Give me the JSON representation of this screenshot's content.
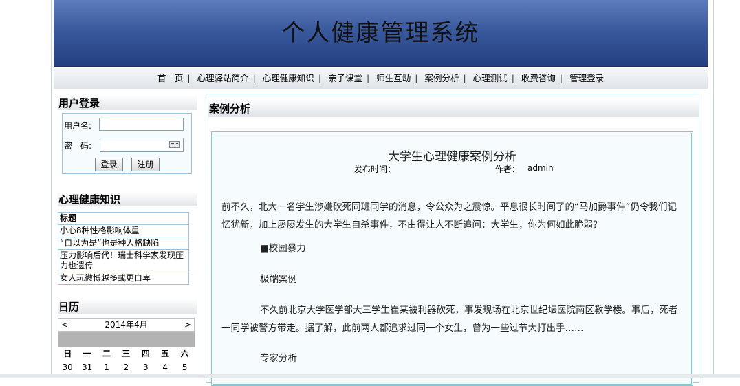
{
  "banner": {
    "title": "个人健康管理系统"
  },
  "nav": {
    "items": [
      "首　页",
      "心理驿站简介",
      "心理健康知识",
      "亲子课堂",
      "师生互动",
      "案例分析",
      "心理测试",
      "收费咨询",
      "管理登录"
    ],
    "separator": "|"
  },
  "login": {
    "title": "用户登录",
    "username_label": "用户名:",
    "password_label": "密　码:",
    "username_value": "",
    "password_value": "",
    "login_button": "登录",
    "register_button": "注册"
  },
  "knowledge": {
    "title": "心理健康知识",
    "header": "标题",
    "items": [
      "小心8种性格影响体重",
      "“自以为是”也是种人格缺陷",
      "压力影响后代！瑞士科学家发现压力也遗传",
      "女人玩微博越多或更自卑"
    ]
  },
  "calendar": {
    "title": "日历",
    "month": "2014年4月",
    "prev": "<",
    "next": ">",
    "weekdays": [
      "日",
      "一",
      "二",
      "三",
      "四",
      "五",
      "六"
    ],
    "first_row": [
      "30",
      "31",
      "1",
      "2",
      "3",
      "4",
      "5"
    ]
  },
  "main": {
    "title": "案例分析",
    "article": {
      "title": "大学生心理健康案例分析",
      "publish_label": "发布时间：",
      "author_label": "作者：",
      "author": "admin",
      "p1": "前不久，北大一名学生涉嫌砍死同班同学的消息，令公众为之震惊。平息很长时间了的“马加爵事件”仍令我们记忆犹新，加上屡屡发生的大学生自杀事件，不由得让人不断追问：大学生，你为何如此脆弱？",
      "s1": "■校园暴力",
      "s2": "极端案例",
      "p2": "不久前北京大学医学部大三学生崔某被利器砍死，事发现场在北京世纪坛医院南区教学楼。事后，死者一同学被警方带走。据了解，此前两人都追求过同一个女生，曾为一些过节大打出手……",
      "s3": "专家分析"
    }
  }
}
